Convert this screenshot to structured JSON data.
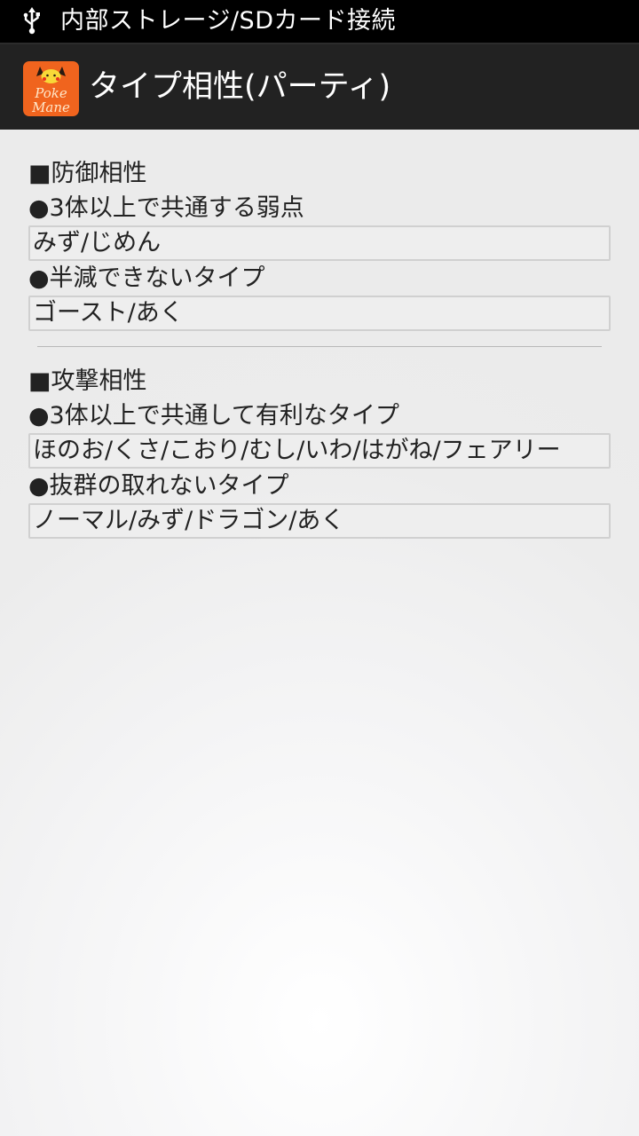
{
  "status_bar": {
    "icon": "usb-icon",
    "text": "内部ストレージ/SDカード接続"
  },
  "action_bar": {
    "icon": "pokemane-app-icon",
    "icon_text_line1": "Poke",
    "icon_text_line2": "Mane",
    "title": "タイプ相性(パーティ)"
  },
  "defense": {
    "heading": "■防御相性",
    "common_weakness_label": "●3体以上で共通する弱点",
    "common_weakness_value": "みず/じめん",
    "not_resisted_label": "●半減できないタイプ",
    "not_resisted_value": "ゴースト/あく"
  },
  "attack": {
    "heading": "■攻撃相性",
    "common_advantage_label": "●3体以上で共通して有利なタイプ",
    "common_advantage_value": "ほのお/くさ/こおり/むし/いわ/はがね/フェアリー",
    "no_super_effective_label": "●抜群の取れないタイプ",
    "no_super_effective_value": "ノーマル/みず/ドラゴン/あく"
  },
  "colors": {
    "status_bar_bg": "#000000",
    "action_bar_bg": "#222222",
    "app_icon_bg": "#f0641e",
    "page_bg": "#ebebeb"
  }
}
